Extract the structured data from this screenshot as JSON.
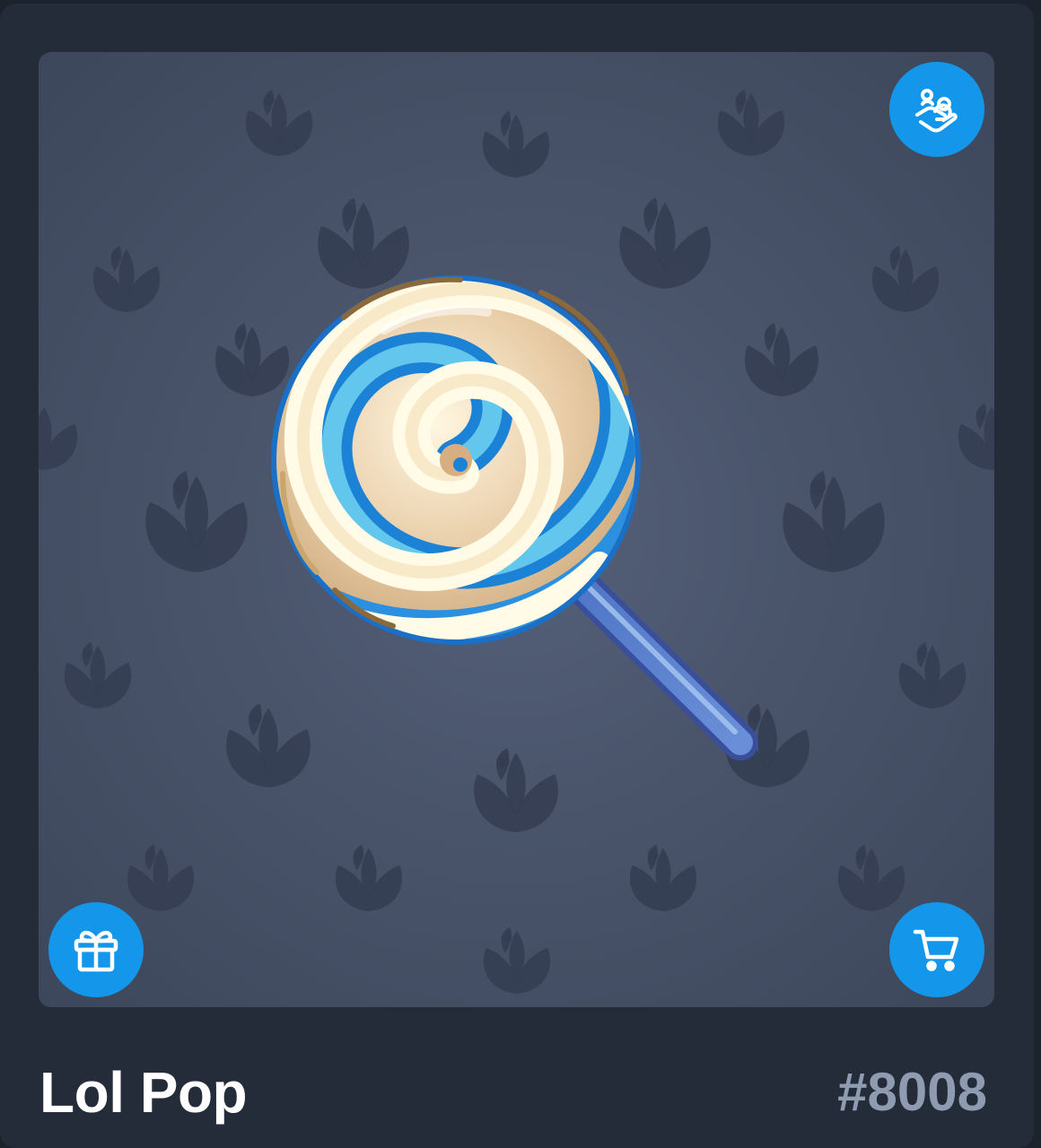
{
  "gift": {
    "name": "Lol Pop",
    "number": "#8008"
  },
  "buttons": {
    "transfer_icon": "hand-with-people-icon",
    "send_icon": "gift-icon",
    "buy_icon": "cart-icon"
  },
  "theme": {
    "accent": "#1497ea",
    "backdrop": "#4a556c",
    "pattern_color": "#343d51",
    "card_background": "#232c38",
    "title_color": "#ffffff",
    "number_color": "#8e9bb1"
  },
  "model": {
    "icon": "lollipop-icon",
    "colors": [
      "#1a78d2",
      "#5cc3ea",
      "#fffbe4",
      "#d6ae82",
      "#a98a5a"
    ]
  },
  "pattern": {
    "symbol": "lotus-flower-icon"
  }
}
